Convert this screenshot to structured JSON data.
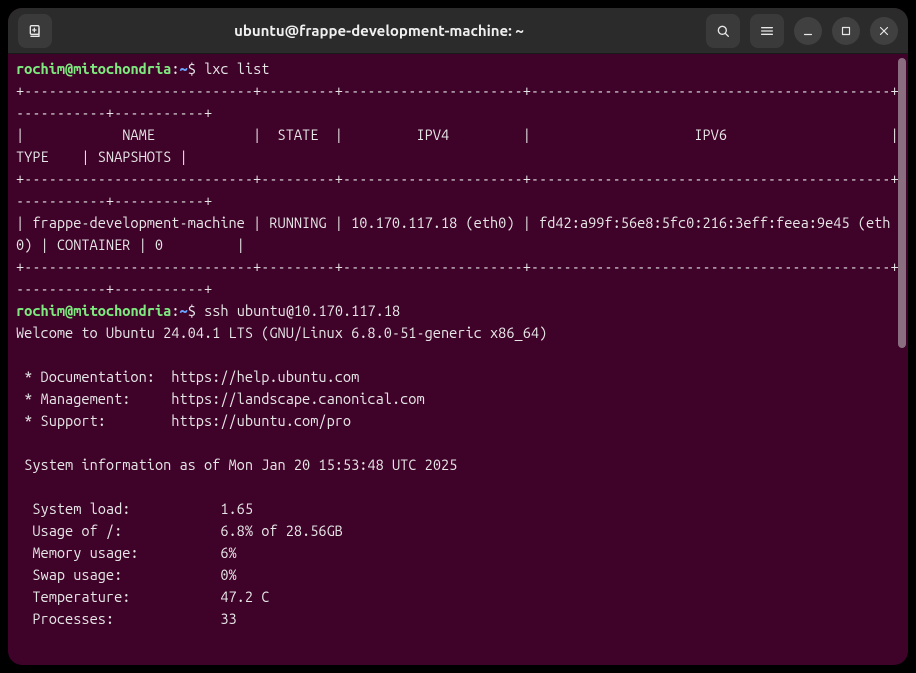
{
  "window": {
    "title": "ubuntu@frappe-development-machine: ~"
  },
  "prompt1": {
    "user": "rochim",
    "at": "@",
    "host": "mitochondria",
    "colon": ":",
    "path": "~",
    "dollar": "$",
    "command": "lxc list"
  },
  "lxc_output": "+----------------------------+---------+----------------------+--------------------------------------------+-----------+-----------+\n|            NAME            |  STATE  |         IPV4         |                    IPV6                    |   TYPE    | SNAPSHOTS |\n+----------------------------+---------+----------------------+--------------------------------------------+-----------+-----------+\n| frappe-development-machine | RUNNING | 10.170.117.18 (eth0) | fd42:a99f:56e8:5fc0:216:3eff:feea:9e45 (eth0) | CONTAINER | 0         |\n+----------------------------+---------+----------------------+--------------------------------------------+-----------+-----------+",
  "prompt2": {
    "user": "rochim",
    "at": "@",
    "host": "mitochondria",
    "colon": ":",
    "path": "~",
    "dollar": "$",
    "command": "ssh ubuntu@10.170.117.18"
  },
  "ssh_output": "Welcome to Ubuntu 24.04.1 LTS (GNU/Linux 6.8.0-51-generic x86_64)\n\n * Documentation:  https://help.ubuntu.com\n * Management:     https://landscape.canonical.com\n * Support:        https://ubuntu.com/pro\n\n System information as of Mon Jan 20 15:53:48 UTC 2025\n\n  System load:           1.65\n  Usage of /:            6.8% of 28.56GB\n  Memory usage:          6%\n  Swap usage:            0%\n  Temperature:           47.2 C\n  Processes:             33"
}
